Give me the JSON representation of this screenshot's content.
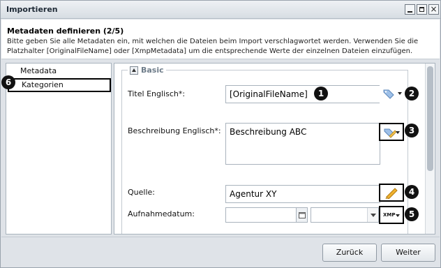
{
  "window": {
    "title": "Importieren",
    "controls": {
      "minimize_icon": "minimize-icon",
      "maximize_icon": "maximize-icon",
      "close_glyph": "×"
    }
  },
  "header": {
    "title": "Metadaten definieren (2/5)",
    "description": "Bitte geben Sie alle Metadaten ein, mit welchen die Dateien beim Import verschlagwortet werden. Verwenden Sie die Platzhalter [OriginalFileName] oder [XmpMetadata] um die entsprechende Werte der einzelnen Dateien einzufügen."
  },
  "sidebar": {
    "items": [
      {
        "label": "Metadata"
      },
      {
        "label": "Kategorien"
      }
    ]
  },
  "form": {
    "section_label": "Basic",
    "fields": [
      {
        "label": "Titel Englisch*:",
        "value": "[OriginalFileName]"
      },
      {
        "label": "Beschreibung Englisch*:",
        "value": "Beschreibung ABC"
      },
      {
        "label": "Quelle:",
        "value": "Agentur XY"
      },
      {
        "label": "Aufnahmedatum:",
        "value": ""
      }
    ],
    "xmp_label": "XMP"
  },
  "callouts": [
    "1",
    "2",
    "3",
    "4",
    "5",
    "6"
  ],
  "footer": {
    "back_label": "Zurück",
    "next_label": "Weiter"
  },
  "colors": {
    "accent_section": "#6f7d8a",
    "window_bg": "#dfe3e8",
    "tag_icon": "#7aa3d6",
    "pencil_icon": "#e5a21a"
  }
}
